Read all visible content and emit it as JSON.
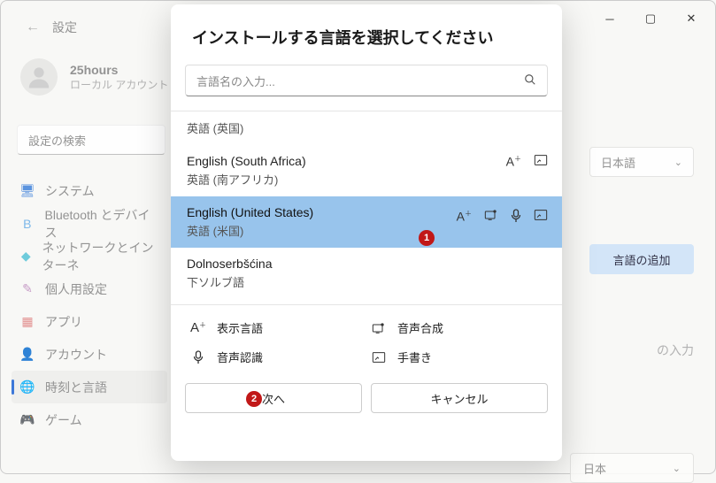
{
  "window": {
    "back_label": "設定"
  },
  "profile": {
    "name": "25hours",
    "sub": "ローカル アカウント"
  },
  "search_bg": {
    "placeholder": "設定の検索"
  },
  "nav": {
    "items": [
      {
        "label": "システム",
        "icon": "🖥",
        "color": "#4a89dc"
      },
      {
        "label": "Bluetooth とデバイス",
        "icon": "B",
        "color": "#6fb0e8"
      },
      {
        "label": "ネットワークとインターネ",
        "icon": "◆",
        "color": "#5fc6d8"
      },
      {
        "label": "個人用設定",
        "icon": "✎",
        "color": "#c090c0"
      },
      {
        "label": "アプリ",
        "icon": "▦",
        "color": "#e08585"
      },
      {
        "label": "アカウント",
        "icon": "👤",
        "color": "#7fb17f"
      },
      {
        "label": "時刻と言語",
        "icon": "🌐",
        "color": "#4a89dc"
      },
      {
        "label": "ゲーム",
        "icon": "🎮",
        "color": "#b5b58c"
      }
    ]
  },
  "right": {
    "lang_current": "日本語",
    "add_button": "言語の追加",
    "placeholder_partial": "﻿﻿の入力",
    "country_partial": "﻿﻿日本"
  },
  "modal": {
    "title": "インストールする言語を選択してください",
    "search_placeholder": "言語名の入力...",
    "languages": [
      {
        "native": "",
        "local": "英語 (英国)",
        "icons": []
      },
      {
        "native": "English (South Africa)",
        "local": "英語 (南アフリカ)",
        "icons": [
          "A",
          "pen"
        ]
      },
      {
        "native": "English (United States)",
        "local": "英語 (米国)",
        "icons": [
          "A",
          "tts",
          "mic",
          "pen"
        ],
        "selected": true
      },
      {
        "native": "Dolnoserbšćina",
        "local": "下ソルブ語",
        "icons": []
      }
    ],
    "legend": {
      "display": "表示言語",
      "tts": "音声合成",
      "stt": "音声認識",
      "hand": "手書き"
    },
    "actions": {
      "next": "次へ",
      "cancel": "キャンセル"
    },
    "badge1": "1",
    "badge2": "2"
  }
}
